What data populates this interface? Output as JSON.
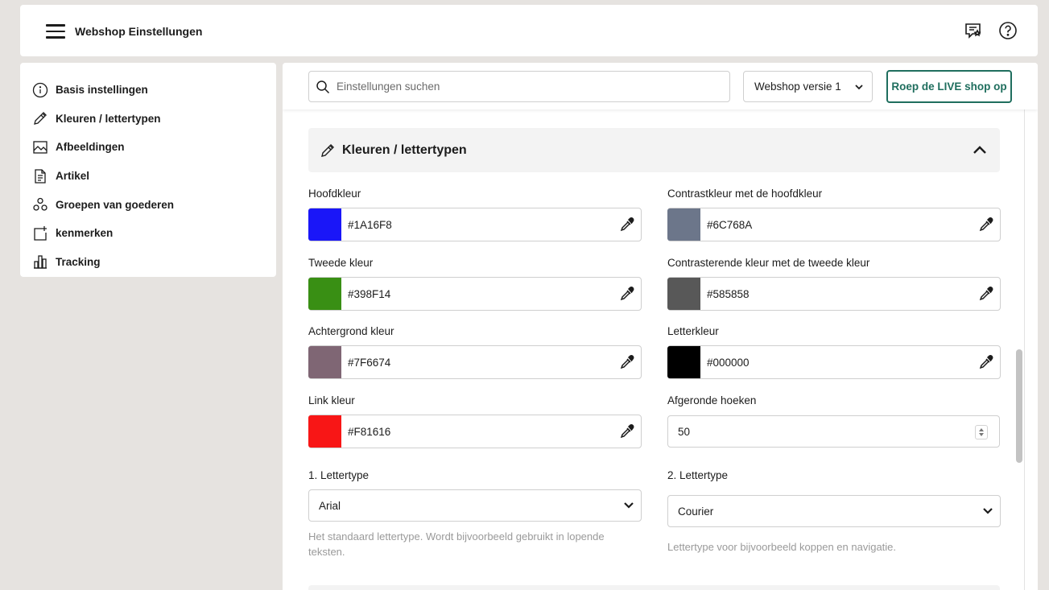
{
  "header": {
    "title": "Webshop Einstellungen",
    "icons": [
      "menu-icon",
      "feedback-icon",
      "help-icon"
    ]
  },
  "sidebar": {
    "items": [
      {
        "label": "Basis instellingen",
        "icon": "info-icon"
      },
      {
        "label": "Kleuren / lettertypen",
        "icon": "pen-icon"
      },
      {
        "label": "Afbeeldingen",
        "icon": "image-icon"
      },
      {
        "label": "Artikel",
        "icon": "document-icon"
      },
      {
        "label": "Groepen van goederen",
        "icon": "groups-icon"
      },
      {
        "label": "kenmerken",
        "icon": "add-attribute-icon"
      },
      {
        "label": "Tracking",
        "icon": "bar-chart-icon"
      }
    ]
  },
  "toolbar": {
    "search_placeholder": "Einstellungen suchen",
    "version_selected": "Webshop versie 1",
    "live_button": "Roep de LIVE shop op"
  },
  "section": {
    "title": "Kleuren / lettertypen",
    "fields": {
      "primary": {
        "label": "Hoofdkleur",
        "value": "#1A16F8",
        "swatch": "#1A16F8"
      },
      "primary_contrast": {
        "label": "Contrastkleur met de hoofdkleur",
        "value": "#6C768A",
        "swatch": "#6C768A"
      },
      "secondary": {
        "label": "Tweede kleur",
        "value": "#398F14",
        "swatch": "#398F14"
      },
      "secondary_contrast": {
        "label": "Contrasterende kleur met de tweede kleur",
        "value": "#585858",
        "swatch": "#585858"
      },
      "background": {
        "label": "Achtergrond kleur",
        "value": "#7F6674",
        "swatch": "#7F6674"
      },
      "text_color": {
        "label": "Letterkleur",
        "value": "#000000",
        "swatch": "#000000"
      },
      "link": {
        "label": "Link kleur",
        "value": "#F81616",
        "swatch": "#F81616"
      },
      "rounded": {
        "label": "Afgeronde hoeken",
        "value": "50"
      },
      "font1": {
        "label": "1. Lettertype",
        "value": "Arial",
        "help": "Het standaard lettertype. Wordt bijvoorbeeld gebruikt in lopende teksten."
      },
      "font2": {
        "label": "2. Lettertype",
        "value": "Courier",
        "help": "Lettertype voor bijvoorbeeld koppen en navigatie."
      }
    }
  },
  "colors": {
    "accent": "#1f6e5e",
    "background": "#e6e3e0"
  }
}
